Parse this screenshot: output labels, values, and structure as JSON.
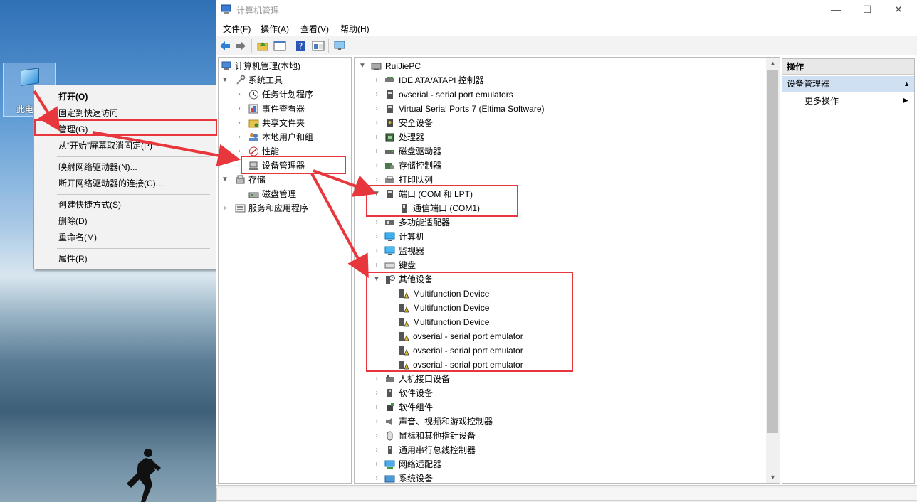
{
  "desktop": {
    "icon_label": "此电"
  },
  "context_menu": {
    "items": [
      {
        "label": "打开(O)",
        "bold": true
      },
      {
        "label": "固定到快速访问"
      },
      {
        "label": "管理(G)"
      },
      {
        "label": "从“开始”屏幕取消固定(P)"
      },
      {
        "label": "映射网络驱动器(N)..."
      },
      {
        "label": "断开网络驱动器的连接(C)..."
      },
      {
        "label": "创建快捷方式(S)"
      },
      {
        "label": "删除(D)"
      },
      {
        "label": "重命名(M)"
      },
      {
        "label": "属性(R)"
      }
    ]
  },
  "window": {
    "title": "计算机管理",
    "menu": [
      "文件(F)",
      "操作(A)",
      "查看(V)",
      "帮助(H)"
    ],
    "controls": {
      "minimize": "—",
      "maximize": "☐",
      "close": "✕"
    }
  },
  "left_tree": {
    "root": "计算机管理(本地)",
    "system_tools": "系统工具",
    "system_tools_children": [
      "任务计划程序",
      "事件查看器",
      "共享文件夹",
      "本地用户和组",
      "性能",
      "设备管理器"
    ],
    "storage": "存储",
    "storage_children": [
      "磁盘管理"
    ],
    "services": "服务和应用程序"
  },
  "device_tree": {
    "root": "RuiJiePC",
    "nodes": [
      {
        "label": "IDE ATA/ATAPI 控制器",
        "icon": "ide-icon"
      },
      {
        "label": "ovserial - serial port emulators",
        "icon": "port-icon"
      },
      {
        "label": "Virtual Serial Ports 7 (Eltima Software)",
        "icon": "port-icon"
      },
      {
        "label": "安全设备",
        "icon": "security-icon"
      },
      {
        "label": "处理器",
        "icon": "cpu-icon"
      },
      {
        "label": "磁盘驱动器",
        "icon": "disk-icon"
      },
      {
        "label": "存储控制器",
        "icon": "storage-icon"
      },
      {
        "label": "打印队列",
        "icon": "printer-icon"
      },
      {
        "label": "端口 (COM 和 LPT)",
        "icon": "port-icon",
        "expanded": true,
        "children": [
          "通信端口 (COM1)"
        ]
      },
      {
        "label": "多功能适配器",
        "icon": "adapter-icon"
      },
      {
        "label": "计算机",
        "icon": "computer-icon"
      },
      {
        "label": "监视器",
        "icon": "monitor-icon"
      },
      {
        "label": "键盘",
        "icon": "keyboard-icon"
      },
      {
        "label": "其他设备",
        "icon": "unknown-device-icon",
        "expanded": true,
        "children": [
          "Multifunction Device",
          "Multifunction Device",
          "Multifunction Device",
          "ovserial - serial port emulator",
          "ovserial - serial port emulator",
          "ovserial - serial port emulator"
        ]
      },
      {
        "label": "人机接口设备",
        "icon": "hid-icon"
      },
      {
        "label": "软件设备",
        "icon": "software-device-icon"
      },
      {
        "label": "软件组件",
        "icon": "software-component-icon"
      },
      {
        "label": "声音、视频和游戏控制器",
        "icon": "sound-icon"
      },
      {
        "label": "鼠标和其他指针设备",
        "icon": "mouse-icon"
      },
      {
        "label": "通用串行总线控制器",
        "icon": "usb-icon"
      },
      {
        "label": "网络适配器",
        "icon": "network-icon"
      },
      {
        "label": "系统设备",
        "icon": "system-device-icon"
      }
    ]
  },
  "actions_pane": {
    "header": "操作",
    "selected": "设备管理器",
    "more": "更多操作"
  },
  "colors": {
    "annotation": "#e8373c",
    "selection": "#cfe0f3"
  }
}
